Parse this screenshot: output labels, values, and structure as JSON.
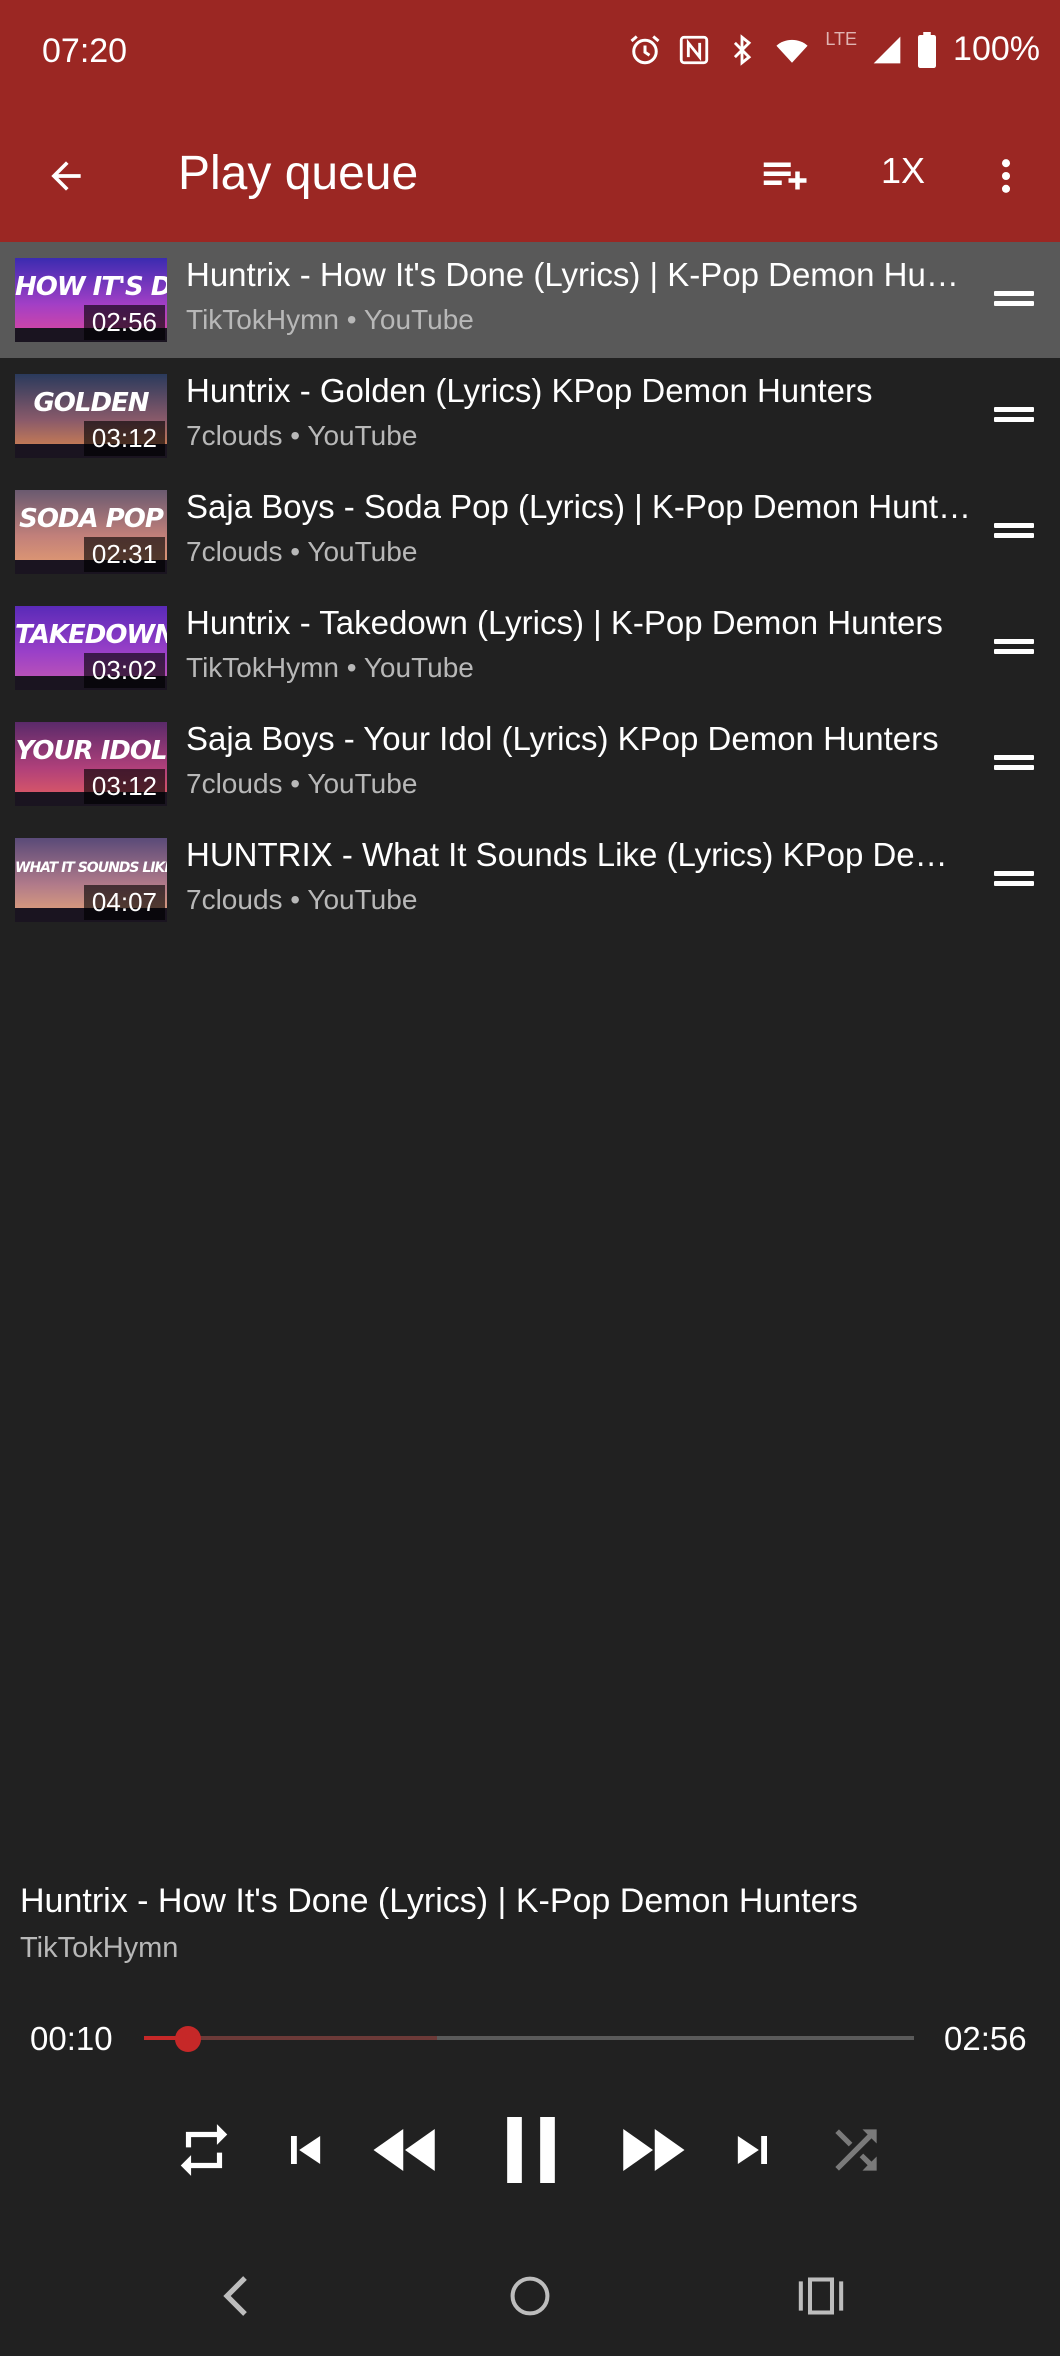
{
  "status_bar": {
    "time": "07:20",
    "network": "LTE",
    "battery": "100%",
    "icons": [
      "alarm-icon",
      "nfc-icon",
      "bluetooth-icon",
      "wifi-icon",
      "signal-icon",
      "battery-icon"
    ]
  },
  "app_bar": {
    "title": "Play queue",
    "speed": "1X",
    "icons": [
      "back-arrow-icon",
      "playlist-add-icon",
      "more-vert-icon"
    ]
  },
  "queue": [
    {
      "thumb_text": "HOW IT'S DONE",
      "duration": "02:56",
      "title": "Huntrix - How It's Done (Lyrics) | K-Pop Demon Hunters",
      "subtitle": "TikTokHymn • YouTube",
      "active": true,
      "thumb_colors": [
        "#3b2bb0",
        "#a23fc6",
        "#e2489a"
      ]
    },
    {
      "thumb_text": "GOLDEN",
      "duration": "03:12",
      "title": "Huntrix - Golden (Lyrics) KPop Demon Hunters",
      "subtitle": "7clouds • YouTube",
      "active": false,
      "thumb_colors": [
        "#2a3a5c",
        "#8a5a6a",
        "#e08a4c"
      ]
    },
    {
      "thumb_text": "SODA POP",
      "duration": "02:31",
      "title": "Saja Boys - Soda Pop (Lyrics) | K-Pop Demon Hunters",
      "subtitle": "7clouds • YouTube",
      "active": false,
      "thumb_colors": [
        "#6a5a70",
        "#c2807a",
        "#e8a070"
      ]
    },
    {
      "thumb_text": "TAKEDOWN",
      "duration": "03:02",
      "title": "Huntrix - Takedown (Lyrics) | K-Pop Demon Hunters",
      "subtitle": "TikTokHymn • YouTube",
      "active": false,
      "thumb_colors": [
        "#5a2ab8",
        "#9a40c8",
        "#c85ab0"
      ]
    },
    {
      "thumb_text": "YOUR IDOL",
      "duration": "03:12",
      "title": "Saja Boys - Your Idol (Lyrics) KPop Demon Hunters",
      "subtitle": "7clouds • YouTube",
      "active": false,
      "thumb_colors": [
        "#5a2a6a",
        "#b0407a",
        "#e86060"
      ]
    },
    {
      "thumb_text": "WHAT IT SOUNDS LIKE",
      "duration": "04:07",
      "title": "HUNTRIX - What It Sounds Like (Lyrics) KPop Demon Hunters",
      "subtitle": "7clouds • YouTube",
      "active": false,
      "thumb_colors": [
        "#5a4a78",
        "#b07a8a",
        "#e8a878"
      ]
    }
  ],
  "now_playing": {
    "title": "Huntrix - How It's Done (Lyrics) | K-Pop Demon Hunters",
    "channel": "TikTokHymn",
    "current_time": "00:10",
    "total_time": "02:56",
    "progress_fraction": 0.057,
    "buffered_fraction": 0.38
  },
  "controls": {
    "icons": [
      "repeat-icon",
      "skip-previous-icon",
      "rewind-icon",
      "pause-icon",
      "fast-forward-icon",
      "skip-next-icon",
      "shuffle-icon"
    ]
  },
  "nav_bar": {
    "icons": [
      "nav-back-icon",
      "nav-home-icon",
      "nav-recents-icon"
    ]
  },
  "colors": {
    "app_bar": "#9b2723",
    "background": "#212121",
    "active_row": "#595959",
    "accent": "#c62828",
    "secondary_text": "#b8b8b8"
  }
}
